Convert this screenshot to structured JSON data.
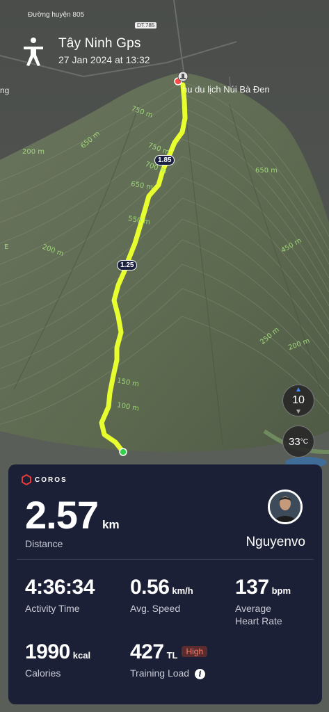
{
  "map": {
    "title": "Tây Ninh Gps",
    "datetime": "27 Jan 2024 at 13:32",
    "road_name": "Đường huyện 805",
    "road_badge": "DT.785",
    "poi_label": "hu du lịch Núi Bà Đen",
    "edge_label": "ng",
    "km_markers": [
      "1.85",
      "1.25"
    ],
    "contour_labels": [
      "750 m",
      "750 m",
      "700 m",
      "650 m",
      "650 m",
      "650 m",
      "550 m",
      "450 m",
      "200 m",
      "150 m",
      "100 m",
      "250 m",
      "200 m",
      "200 m",
      "E"
    ],
    "zoom_level": "10",
    "zoom_compass": "N",
    "temperature": "33",
    "temperature_unit": "°C",
    "colors": {
      "track": "#e7ff2e",
      "start": "#33d14a",
      "end": "#ff4b4b"
    }
  },
  "card": {
    "brand": "COROS",
    "distance_value": "2.57",
    "distance_unit": "km",
    "distance_label": "Distance",
    "username": "Nguyenvo",
    "stats": [
      {
        "value": "4:36:34",
        "unit": "",
        "label": "Activity Time"
      },
      {
        "value": "0.56",
        "unit": "km/h",
        "label": "Avg. Speed"
      },
      {
        "value": "137",
        "unit": "bpm",
        "label": "Average\nHeart Rate"
      },
      {
        "value": "1990",
        "unit": "kcal",
        "label": "Calories"
      },
      {
        "value": "427",
        "unit": "TL",
        "label": "Training Load",
        "badge": "High"
      }
    ],
    "colors": {
      "background": "#1c2036",
      "badge_bg": "#5b2b2e",
      "badge_text": "#f08070"
    }
  }
}
